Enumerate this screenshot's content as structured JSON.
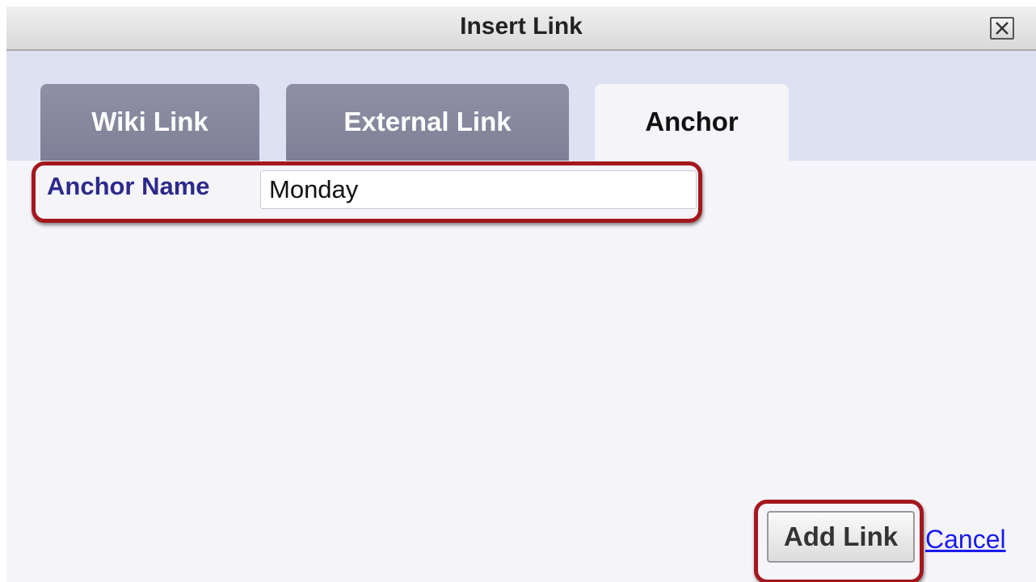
{
  "dialog": {
    "title": "Insert Link",
    "close_icon": "close-x-icon"
  },
  "tabs": [
    {
      "label": "Wiki Link",
      "active": false
    },
    {
      "label": "External Link",
      "active": false
    },
    {
      "label": "Anchor",
      "active": true
    }
  ],
  "anchor_form": {
    "label": "Anchor Name",
    "value": "Monday"
  },
  "actions": {
    "add_label": "Add Link",
    "cancel_label": "Cancel"
  },
  "colors": {
    "highlight": "#a3171d",
    "label_text": "#2c2a8a",
    "link": "#1a1aee",
    "tab_inactive": "#8f90a5"
  }
}
